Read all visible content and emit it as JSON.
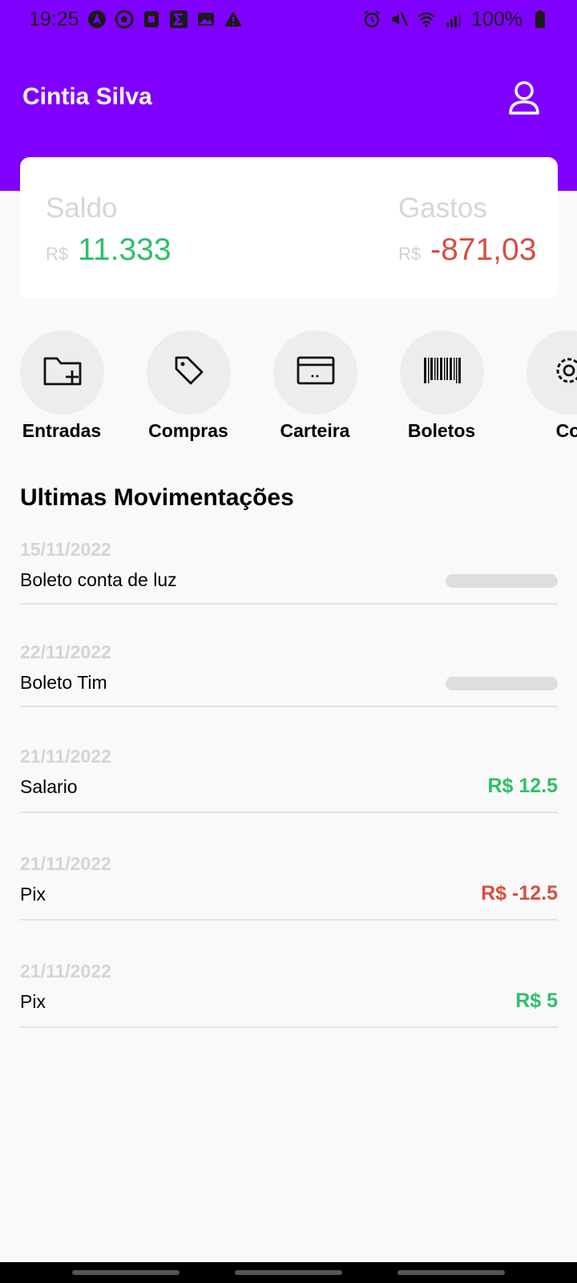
{
  "status_bar": {
    "time": "19:25",
    "battery": "100%",
    "left_icons": [
      "navigation-icon",
      "chrome-icon",
      "app-icon",
      "sigma-icon",
      "gallery-icon",
      "warning-icon"
    ],
    "right_icons": [
      "alarm-icon",
      "mute-icon",
      "wifi-icon",
      "signal-icon",
      "battery-icon"
    ]
  },
  "header": {
    "user_name": "Cintia Silva",
    "profile_icon": "user-icon",
    "background_color": "#8000ff"
  },
  "balance": {
    "saldo_label": "Saldo",
    "saldo_currency": "R$",
    "saldo_value": "11.333",
    "gastos_label": "Gastos",
    "gastos_currency": "R$",
    "gastos_value": "-871,03"
  },
  "actions": [
    {
      "label": "Entradas",
      "icon": "folder-add-icon"
    },
    {
      "label": "Compras",
      "icon": "tag-icon"
    },
    {
      "label": "Carteira",
      "icon": "card-icon"
    },
    {
      "label": "Boletos",
      "icon": "barcode-icon"
    },
    {
      "label": "Co",
      "icon": "gear-icon"
    }
  ],
  "movements": {
    "title": "Ultimas Movimentações",
    "items": [
      {
        "date": "15/11/2022",
        "description": "Boleto conta de luz",
        "amount": null,
        "status": "loading"
      },
      {
        "date": "22/11/2022",
        "description": "Boleto Tim",
        "amount": null,
        "status": "loading"
      },
      {
        "date": "21/11/2022",
        "description": "Salario",
        "amount": "R$ 12.5",
        "status": "positive"
      },
      {
        "date": "21/11/2022",
        "description": "Pix",
        "amount": "R$ -12.5",
        "status": "negative"
      },
      {
        "date": "21/11/2022",
        "description": "Pix",
        "amount": "R$ 5",
        "status": "positive"
      }
    ]
  },
  "colors": {
    "positive": "#2ec06a",
    "negative": "#d94c41",
    "accent": "#8000ff"
  }
}
